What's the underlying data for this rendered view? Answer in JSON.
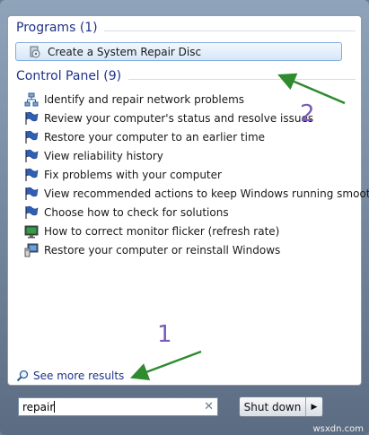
{
  "programs": {
    "header": "Programs (1)",
    "items": [
      {
        "label": "Create a System Repair Disc",
        "icon": "disc-icon"
      }
    ]
  },
  "control_panel": {
    "header": "Control Panel (9)",
    "items": [
      {
        "label": "Identify and repair network problems",
        "icon": "network-icon"
      },
      {
        "label": "Review your computer's status and resolve issues",
        "icon": "flag-icon"
      },
      {
        "label": "Restore your computer to an earlier time",
        "icon": "flag-icon"
      },
      {
        "label": "View reliability history",
        "icon": "flag-icon"
      },
      {
        "label": "Fix problems with your computer",
        "icon": "flag-icon"
      },
      {
        "label": "View recommended actions to keep Windows running smoothly",
        "icon": "flag-icon"
      },
      {
        "label": "Choose how to check for solutions",
        "icon": "flag-icon"
      },
      {
        "label": "How to correct monitor flicker (refresh rate)",
        "icon": "monitor-icon"
      },
      {
        "label": "Restore your computer or reinstall Windows",
        "icon": "computer-icon"
      }
    ]
  },
  "see_more": {
    "label": "See more results",
    "icon": "search-icon"
  },
  "search": {
    "value": "repair",
    "clear_icon": "close-icon"
  },
  "shutdown": {
    "label": "Shut down",
    "arrow_icon": "triangle-right-icon"
  },
  "annotations": {
    "one": "1",
    "two": "2",
    "arrow_color": "#2e8b2e",
    "number_color": "#7a5bb8"
  },
  "watermark": "wsxdn.com"
}
